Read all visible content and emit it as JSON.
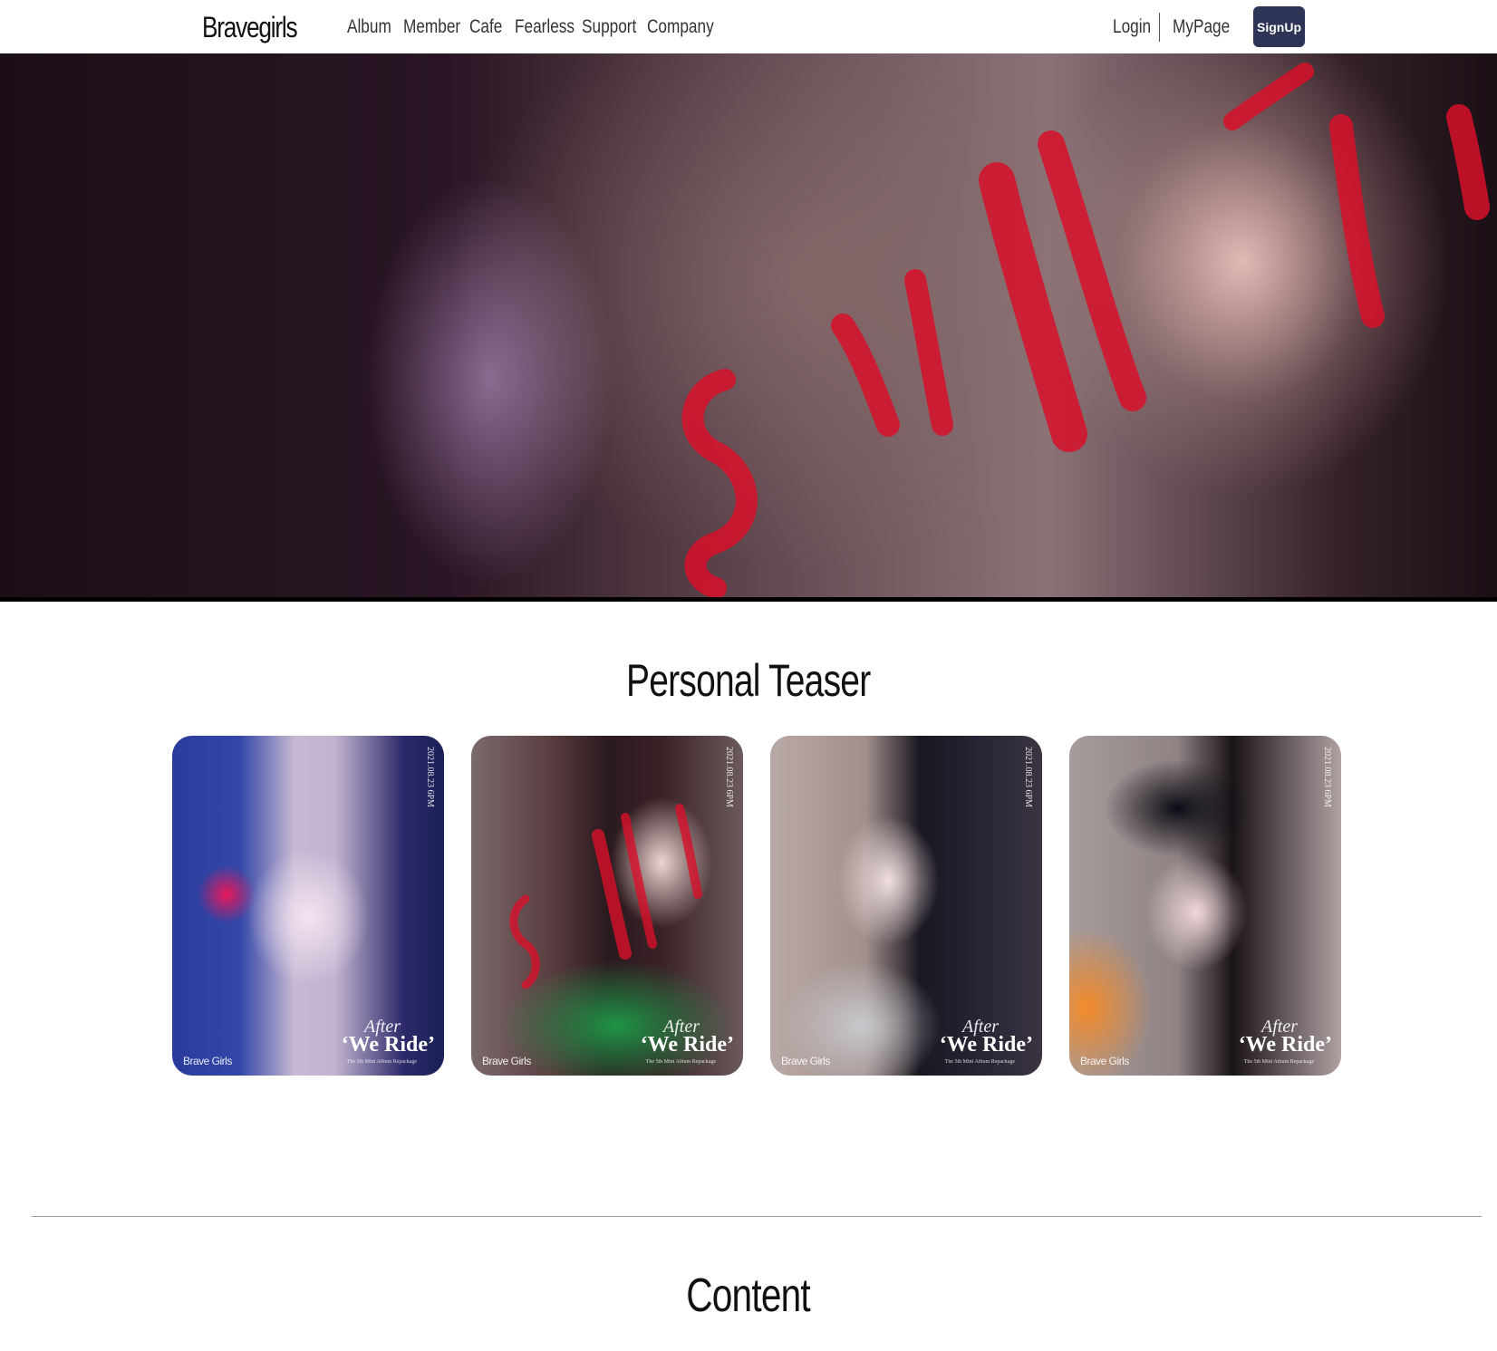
{
  "header": {
    "brand": "Bravegirls",
    "nav": [
      "Album",
      "Member",
      "Cafe",
      "Fearless",
      "Support",
      "Company"
    ],
    "login": "Login",
    "mypage": "MyPage",
    "signup": "SignUp",
    "signup_color": "#2e3456"
  },
  "sections": {
    "teaser_title": "Personal Teaser",
    "content_title": "Content"
  },
  "cards": [
    {
      "member": "card-1",
      "date": "2021.08.23 6PM",
      "logo": "Brave Girls",
      "after": "After",
      "title": "‘We Ride’",
      "sub": "The 5th Mini Album Repackage"
    },
    {
      "member": "card-2",
      "date": "2021.08.23 6PM",
      "logo": "Brave Girls",
      "after": "After",
      "title": "‘We Ride’",
      "sub": "The 5th Mini Album Repackage"
    },
    {
      "member": "card-3",
      "date": "2021.08.23 6PM",
      "logo": "Brave Girls",
      "after": "After",
      "title": "‘We Ride’",
      "sub": "The 5th Mini Album Repackage"
    },
    {
      "member": "card-4",
      "date": "2021.08.23 6PM",
      "logo": "Brave Girls",
      "after": "After",
      "title": "‘We Ride’",
      "sub": "The 5th Mini Album Repackage"
    }
  ]
}
